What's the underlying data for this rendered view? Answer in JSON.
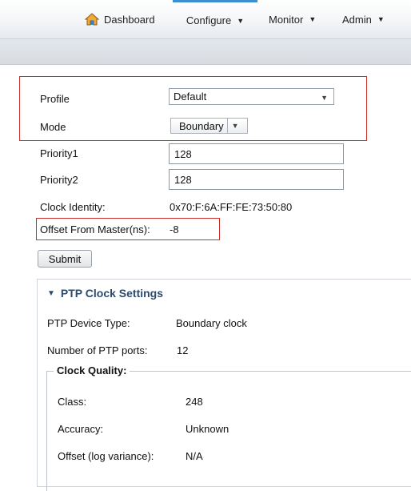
{
  "nav": {
    "dashboard": "Dashboard",
    "configure": "Configure",
    "monitor": "Monitor",
    "admin": "Admin",
    "caret": "▼"
  },
  "form": {
    "profile_label": "Profile",
    "profile_value": "Default",
    "mode_label": "Mode",
    "mode_value": "Boundary",
    "priority1_label": "Priority1",
    "priority1_value": "128",
    "priority2_label": "Priority2",
    "priority2_value": "128",
    "clock_identity_label": "Clock Identity:",
    "clock_identity_value": "0x70:F:6A:FF:FE:73:50:80",
    "offset_label": "Offset From Master(ns):",
    "offset_value": "-8",
    "submit_label": "Submit"
  },
  "ptp": {
    "header": "PTP Clock Settings",
    "device_type_label": "PTP Device Type:",
    "device_type_value": "Boundary clock",
    "num_ports_label": "Number of PTP ports:",
    "num_ports_value": "12",
    "clock_quality_legend": "Clock Quality:",
    "class_label": "Class:",
    "class_value": "248",
    "accuracy_label": "Accuracy:",
    "accuracy_value": "Unknown",
    "offset_label": "Offset (log variance):",
    "offset_value": "N/A"
  },
  "colors": {
    "highlight_box": "#cc2e2e",
    "active_tab": "#3b8fd0",
    "panel_header": "#2c4a6b"
  }
}
